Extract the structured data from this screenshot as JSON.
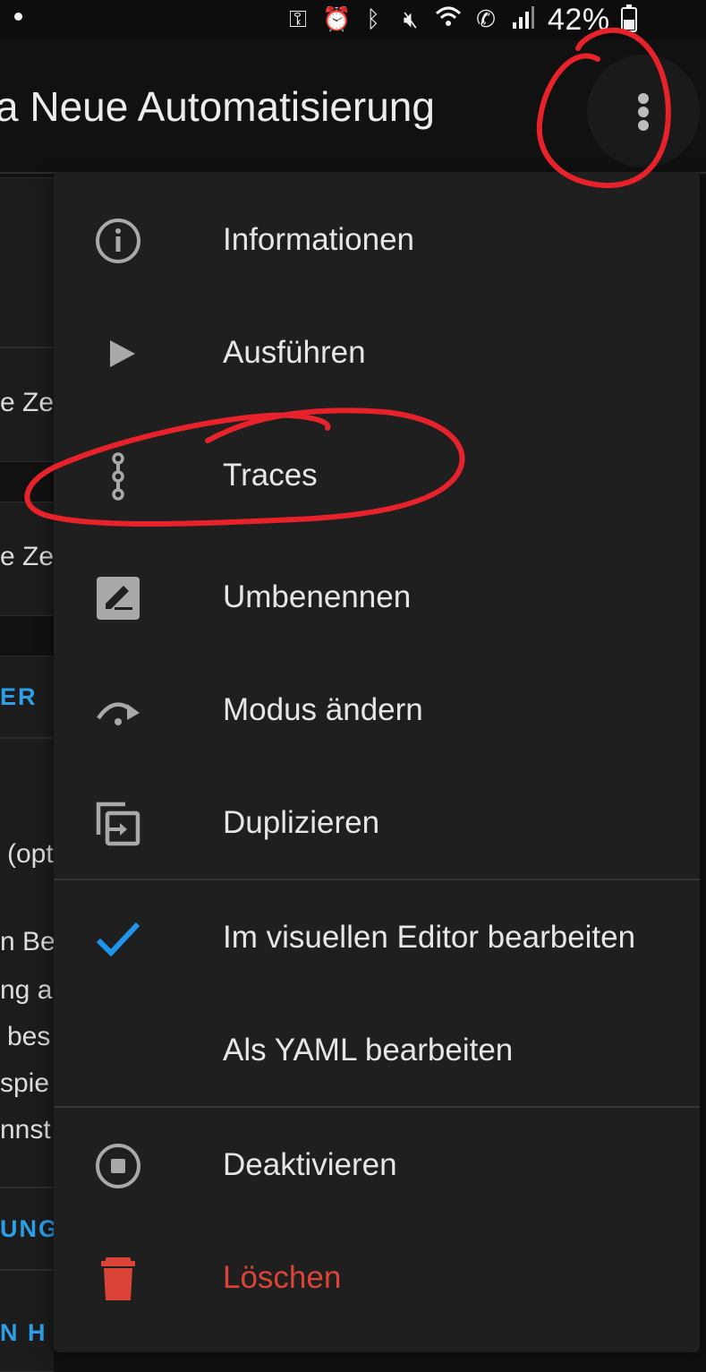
{
  "status_bar": {
    "battery_text": "42%",
    "icons": [
      "vpn-key-icon",
      "alarm-icon",
      "bluetooth-icon",
      "mute-icon",
      "wifi-icon",
      "wifi-call-icon",
      "signal-icon",
      "battery-icon"
    ]
  },
  "header": {
    "title": "a Neue Automatisierung",
    "overflow_menu_icon": "more-vert-icon"
  },
  "background_page": {
    "fragments": [
      "e Ze",
      "e Ze",
      "ER",
      "(opt",
      "n Be",
      "ng a",
      "bes",
      "spie",
      "nnst",
      "UNG",
      "N H"
    ]
  },
  "menu": {
    "items": [
      {
        "label": "Informationen",
        "icon": "info-icon"
      },
      {
        "label": "Ausführen",
        "icon": "play-icon"
      },
      {
        "label": "Traces",
        "icon": "traces-icon"
      },
      {
        "label": "Umbenennen",
        "icon": "rename-icon"
      },
      {
        "label": "Modus ändern",
        "icon": "mode-change-icon"
      },
      {
        "label": "Duplizieren",
        "icon": "duplicate-icon"
      },
      {
        "label": "Im visuellen Editor bearbeiten",
        "icon": "check-icon",
        "selected": true
      },
      {
        "label": "Als YAML bearbeiten",
        "icon": ""
      },
      {
        "label": "Deaktivieren",
        "icon": "stop-circle-icon"
      },
      {
        "label": "Löschen",
        "icon": "delete-icon",
        "danger": true
      }
    ]
  },
  "colors": {
    "accent": "#2d9ee8",
    "check": "#1e96f0",
    "danger": "#db4437",
    "annotation": "#e8222b",
    "menu_bg": "#1f1f1f",
    "page_bg": "#111111"
  }
}
